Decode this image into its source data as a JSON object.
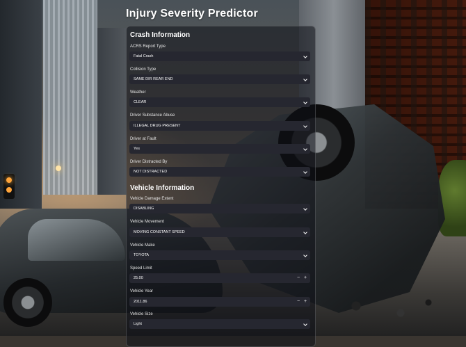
{
  "app": {
    "title": "Injury Severity Predictor"
  },
  "sections": {
    "crash": "Crash Information",
    "vehicle": "Vehicle Information"
  },
  "fields": {
    "acrs_report_type": {
      "label": "ACRS Report Type",
      "value": "Fatal Crash"
    },
    "collision_type": {
      "label": "Collision Type",
      "value": "SAME DIR REAR END"
    },
    "weather": {
      "label": "Weather",
      "value": "CLEAR"
    },
    "driver_substance_abuse": {
      "label": "Driver Substance Abuse",
      "value": "ILLEGAL DRUG PRESENT"
    },
    "driver_at_fault": {
      "label": "Driver at Fault",
      "value": "Yes"
    },
    "driver_distracted_by": {
      "label": "Driver Distracted By",
      "value": "NOT DISTRACTED"
    },
    "vehicle_damage_extent": {
      "label": "Vehicle Damage Extent",
      "value": "DISABLING"
    },
    "vehicle_movement": {
      "label": "Vehicle Movement",
      "value": "MOVING CONSTANT SPEED"
    },
    "vehicle_make": {
      "label": "Vehicle Make",
      "value": "TOYOTA"
    },
    "speed_limit": {
      "label": "Speed Limit",
      "value": "25.00",
      "minus": "−",
      "plus": "+"
    },
    "vehicle_year": {
      "label": "Vehicle Year",
      "value": "2011.86",
      "minus": "−",
      "plus": "+"
    },
    "vehicle_size": {
      "label": "Vehicle Size",
      "value": "Light"
    }
  },
  "icons": {
    "dropdown": "chevron-down-icon"
  }
}
